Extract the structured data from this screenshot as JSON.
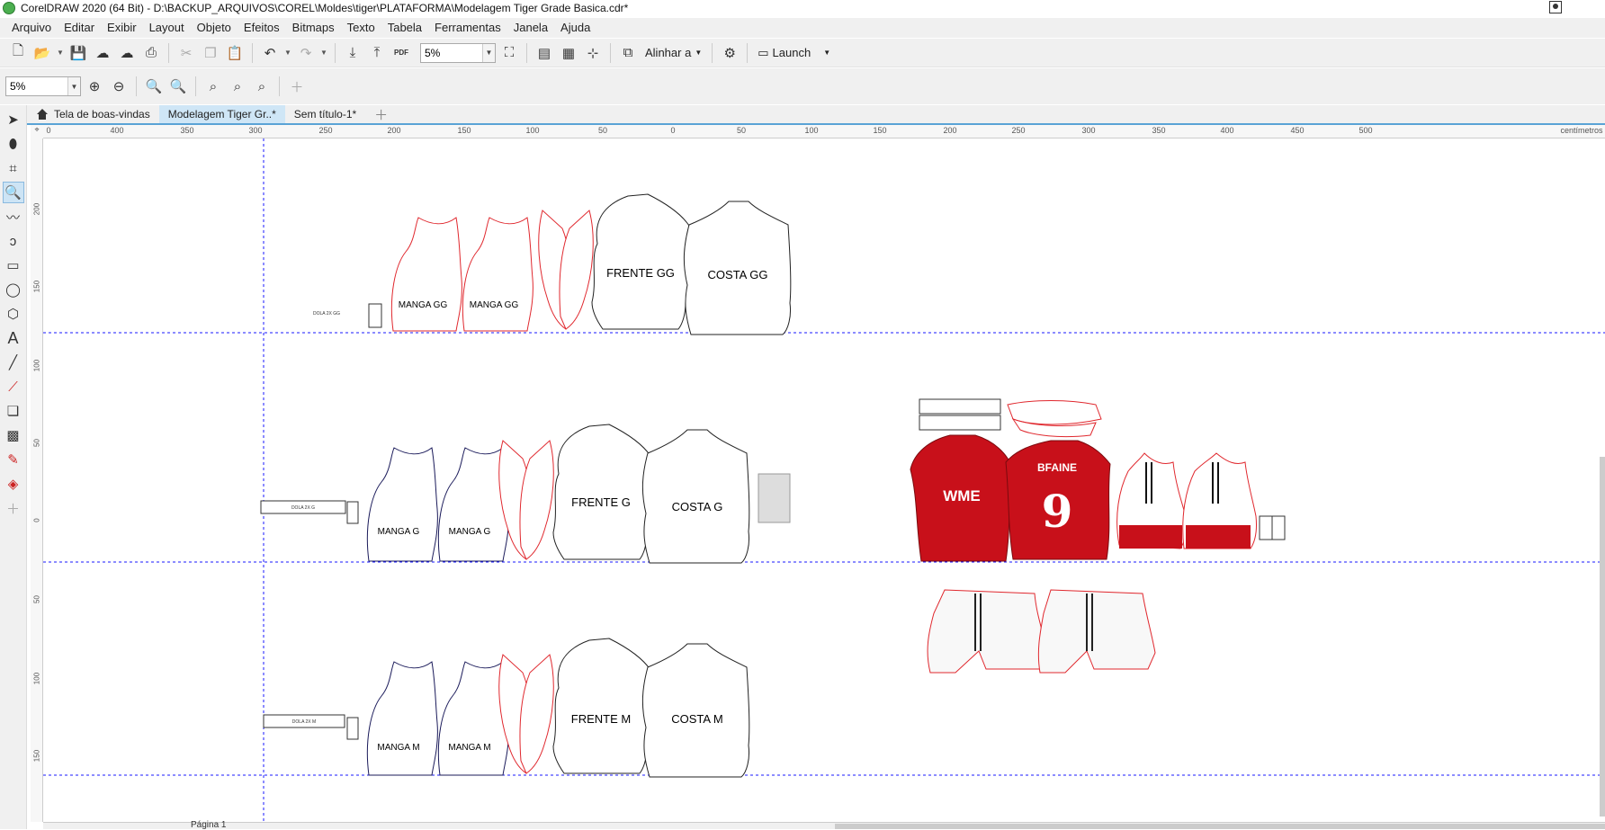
{
  "window": {
    "title": "CorelDRAW 2020 (64 Bit) - D:\\BACKUP_ARQUIVOS\\COREL\\Moldes\\tiger\\PLATAFORMA\\Modelagem Tiger Grade Basica.cdr*"
  },
  "menu": [
    "Arquivo",
    "Editar",
    "Exibir",
    "Layout",
    "Objeto",
    "Efeitos",
    "Bitmaps",
    "Texto",
    "Tabela",
    "Ferramentas",
    "Janela",
    "Ajuda"
  ],
  "toolbar": {
    "zoom_value": "5%",
    "align_label": "Alinhar a",
    "launch_label": "Launch",
    "pdf_label": "PDF"
  },
  "property_bar": {
    "zoom_value": "5%"
  },
  "doc_tabs": [
    {
      "label": "Tela de boas-vindas"
    },
    {
      "label": "Modelagem Tiger Gr..*"
    },
    {
      "label": "Sem título-1*"
    }
  ],
  "ruler": {
    "unit": "centímetros",
    "h_ticks": [
      "0",
      "400",
      "350",
      "300",
      "250",
      "200",
      "150",
      "100",
      "50",
      "0",
      "50",
      "100",
      "150",
      "200",
      "250",
      "300",
      "350",
      "400",
      "450",
      "500"
    ],
    "v_ticks": [
      "200",
      "150",
      "100",
      "50",
      "0",
      "50",
      "100",
      "150"
    ]
  },
  "canvas": {
    "rows": [
      {
        "dola": "DOLA 2X GG",
        "manga_left": "MANGA GG",
        "manga_right": "MANGA GG",
        "frente": "FRENTE GG",
        "costa": "COSTA GG"
      },
      {
        "dola": "DOLA 2X G",
        "manga_left": "MANGA G",
        "manga_right": "MANGA G",
        "frente": "FRENTE G",
        "costa": "COSTA G"
      },
      {
        "dola": "DOLA 2X M",
        "manga_left": "MANGA M",
        "manga_right": "MANGA M",
        "frente": "FRENTE M",
        "costa": "COSTA M"
      }
    ],
    "jersey_front_text": "WME",
    "jersey_back_name": "BFAINE",
    "jersey_back_number": "9",
    "guide_color": "#1a1aff",
    "jersey_red": "#c8101a",
    "outline_red": "#e0282e"
  },
  "status": {
    "page_label": "Página 1"
  }
}
